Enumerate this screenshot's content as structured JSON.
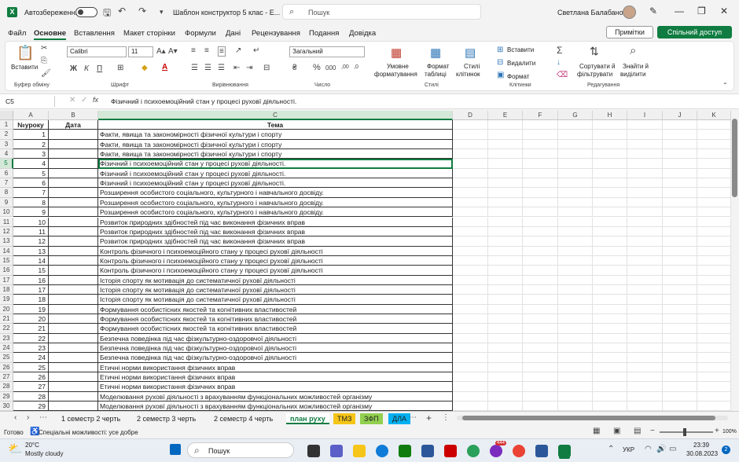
{
  "titlebar": {
    "app_letter": "X",
    "autosave_label": "Автозбереження",
    "autosave_state": "Вимк.",
    "doc_title": "Шаблон конструктор 5 клас  -  E...",
    "search_placeholder": "Пошук",
    "user_name": "Светлана Балабанова"
  },
  "menu": {
    "items": [
      "Файл",
      "Основне",
      "Вставлення",
      "Макет сторінки",
      "Формули",
      "Дані",
      "Рецензування",
      "Подання",
      "Довідка"
    ],
    "active": "Основне",
    "notes_label": "Примітки",
    "share_label": "Спільний доступ"
  },
  "ribbon": {
    "paste_label": "Вставити",
    "clipboard_label": "Буфер обміну",
    "font_name": "Calibri",
    "font_size": "11",
    "font_group_label": "Шрифт",
    "align_group_label": "Вирівнювання",
    "number_format": "Загальний",
    "number_group_label": "Число",
    "cond_format_label1": "Умовне",
    "cond_format_label2": "форматування",
    "table_format_label1": "Формат",
    "table_format_label2": "таблиці",
    "cell_styles_label1": "Стилі",
    "cell_styles_label2": "клітинок",
    "styles_group_label": "Стилі",
    "insert_label": "Вставити",
    "delete_label": "Видалити",
    "format_label": "Формат",
    "cells_group_label": "Клітинки",
    "sort_label1": "Сортувати й",
    "sort_label2": "фільтрувати",
    "find_label1": "Знайти й",
    "find_label2": "виділити",
    "editing_group_label": "Редагування",
    "bold": "Ж",
    "italic": "К",
    "underline": "П"
  },
  "formula_bar": {
    "name_box": "C5",
    "fx": "fx",
    "content": "Фізичний і психоемоційний стан у процесі руховї діяльності."
  },
  "columns": [
    "A",
    "B",
    "C",
    "D",
    "E",
    "F",
    "G",
    "H",
    "I",
    "J",
    "K"
  ],
  "header_row": {
    "a": "№уроку",
    "b": "Дата",
    "c": "Тема"
  },
  "rows": [
    {
      "n": "1",
      "a": "1",
      "c": "Факти, явища та закономірності фізичної культури і спорту"
    },
    {
      "n": "2",
      "a": "2",
      "c": "Факти, явища та закономірності фізичної культури і спорту"
    },
    {
      "n": "3",
      "a": "3",
      "c": "Факти, явища та закономірності фізичної культури і спорту"
    },
    {
      "n": "4",
      "a": "4",
      "c": "Фізичний і психоемоційний стан у процесі руховї діяльності."
    },
    {
      "n": "5",
      "a": "5",
      "c": "Фізичний і психоемоційний стан у процесі руховї діяльності."
    },
    {
      "n": "6",
      "a": "6",
      "c": "Фізичний і психоемоційний стан у процесі руховї діяльності."
    },
    {
      "n": "7",
      "a": "7",
      "c": "Розширення особистого соціального, культурного і навчального досвіду."
    },
    {
      "n": "8",
      "a": "8",
      "c": "Розширення особистого соціального, культурного і навчального досвіду."
    },
    {
      "n": "9",
      "a": "9",
      "c": "Розширення особистого соціального, культурного і навчального досвіду."
    },
    {
      "n": "10",
      "a": "10",
      "c": "Розвиток природних здібностей під час виконання фізичних вправ"
    },
    {
      "n": "11",
      "a": "11",
      "c": "Розвиток природних здібностей під час виконання фізичних вправ"
    },
    {
      "n": "12",
      "a": "12",
      "c": "Розвиток природних здібностей під час виконання фізичних вправ"
    },
    {
      "n": "13",
      "a": "13",
      "c": "Контроль фізичного і психоемоційного стану у процесі руховї діяльності"
    },
    {
      "n": "14",
      "a": "14",
      "c": "Контроль фізичного і психоемоційного стану у процесі руховї діяльності"
    },
    {
      "n": "15",
      "a": "15",
      "c": "Контроль фізичного і психоемоційного стану у процесі руховї діяльності"
    },
    {
      "n": "16",
      "a": "16",
      "c": "Історія спорту як мотивація до систематичної руховї діяльності"
    },
    {
      "n": "17",
      "a": "17",
      "c": "Історія спорту як мотивація до систематичної руховї діяльності"
    },
    {
      "n": "18",
      "a": "18",
      "c": "Історія спорту як мотивація до систематичної руховї діяльності"
    },
    {
      "n": "19",
      "a": "19",
      "c": "Формування особистісних якостей та когнітивних властивостей"
    },
    {
      "n": "20",
      "a": "20",
      "c": "Формування особистісних якостей та когнітивних властивостей"
    },
    {
      "n": "21",
      "a": "21",
      "c": "Формування особистісних якостей та когнітивних властивостей"
    },
    {
      "n": "22",
      "a": "22",
      "c": "Безпечна поведінка під час фізкультурно-оздоровчої діяльності"
    },
    {
      "n": "23",
      "a": "23",
      "c": "Безпечна поведінка під час фізкультурно-оздоровчої діяльності"
    },
    {
      "n": "24",
      "a": "24",
      "c": "Безпечна поведінка під час фізкультурно-оздоровчої діяльності"
    },
    {
      "n": "25",
      "a": "25",
      "c": "Етичні норми використання фізичних вправ"
    },
    {
      "n": "26",
      "a": "26",
      "c": "Етичні норми використання фізичних вправ"
    },
    {
      "n": "27",
      "a": "27",
      "c": "Етичні норми використання фізичних вправ"
    },
    {
      "n": "28",
      "a": "28",
      "c": "Моделювання руховї діяльності з врахуванням  функціональних можливостей організму"
    },
    {
      "n": "29",
      "a": "29",
      "c": "Моделювання руховї діяльності з врахуванням  функціональних можливостей організму"
    }
  ],
  "sheet_tabs": [
    {
      "label": "1 семестр 2 черть",
      "color": ""
    },
    {
      "label": "2 семестр 3 черть",
      "color": ""
    },
    {
      "label": "2 семестр 4 черть",
      "color": ""
    },
    {
      "label": "план руху",
      "color": "",
      "active": true
    },
    {
      "label": "ТМЗ",
      "color": "#f5c518"
    },
    {
      "label": "ЗФП",
      "color": "#92d050"
    },
    {
      "label": "ДЛА",
      "color": "#00b0f0"
    }
  ],
  "status": {
    "ready": "Готово",
    "accessibility": "Спеціальні можливості: усе добре",
    "zoom": "100%"
  },
  "taskbar": {
    "weather_temp": "20°C",
    "weather_desc": "Mostly cloudy",
    "search_label": "Пошук",
    "lang": "УКР",
    "time": "23:39",
    "date": "30.08.2023",
    "badge": "444",
    "notif": "2"
  }
}
